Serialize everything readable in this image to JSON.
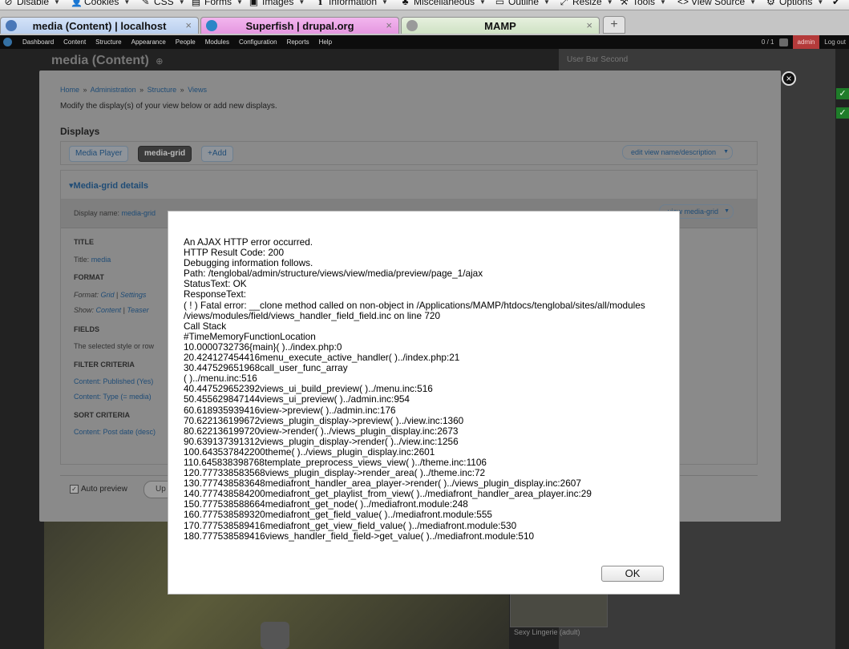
{
  "devbar": {
    "items": [
      {
        "icon": "disable-icon",
        "glyph": "⊘",
        "label": "Disable"
      },
      {
        "icon": "cookies-icon",
        "glyph": "👤",
        "label": "Cookies"
      },
      {
        "icon": "css-icon",
        "glyph": "✎",
        "label": "CSS"
      },
      {
        "icon": "forms-icon",
        "glyph": "▤",
        "label": "Forms"
      },
      {
        "icon": "images-icon",
        "glyph": "▣",
        "label": "Images"
      },
      {
        "icon": "information-icon",
        "glyph": "ℹ",
        "label": "Information"
      },
      {
        "icon": "miscellaneous-icon",
        "glyph": "♣",
        "label": "Miscellaneous"
      },
      {
        "icon": "outline-icon",
        "glyph": "▭",
        "label": "Outline"
      },
      {
        "icon": "resize-icon",
        "glyph": "⤢",
        "label": "Resize"
      },
      {
        "icon": "tools-icon",
        "glyph": "⚒",
        "label": "Tools"
      },
      {
        "icon": "view-source-icon",
        "glyph": "<>",
        "label": "View Source"
      },
      {
        "icon": "options-icon",
        "glyph": "⚙",
        "label": "Options"
      }
    ]
  },
  "tabs": [
    {
      "title": "media (Content) | localhost",
      "close": "×"
    },
    {
      "title": "Superfish | drupal.org",
      "close": "×"
    },
    {
      "title": "MAMP",
      "close": "×"
    }
  ],
  "new_tab": "+",
  "admin_toolbar": {
    "menu": [
      "Dashboard",
      "Content",
      "Structure",
      "Appearance",
      "People",
      "Modules",
      "Configuration",
      "Reports",
      "Help"
    ],
    "counter": "0 / 1",
    "user": "admin",
    "logout": "Log out"
  },
  "page": {
    "title": "media (Content)",
    "right_panel_title": "User Bar Second",
    "thumb_caption": "Sexy Lingerie (adult)"
  },
  "views": {
    "breadcrumb": [
      "Home",
      "Administration",
      "Structure",
      "Views"
    ],
    "breadcrumb_sep": "»",
    "intro": "Modify the display(s) of your view below or add new displays.",
    "displays_title": "Displays",
    "tabs": [
      "Media Player",
      "media-grid",
      "+Add"
    ],
    "edit_name": "edit view name/description",
    "details_title": "Media-grid details",
    "display_name_label": "Display name:",
    "display_name_value": "media-grid",
    "view_button": "view media-grid",
    "sections": {
      "title": "TITLE",
      "title_row_label": "Title:",
      "title_row_value": "media",
      "format": "FORMAT",
      "format_label": "Format:",
      "format_value": "Grid",
      "format_settings": "Settings",
      "show_label": "Show:",
      "show_value": "Content",
      "show_teaser": "Teaser",
      "fields": "FIELDS",
      "fields_note": "The selected style or row",
      "filter": "FILTER CRITERIA",
      "filter_1": "Content: Published (Yes)",
      "filter_2": "Content: Type (= media)",
      "sort": "SORT CRITERIA",
      "sort_1": "Content: Post date (desc)"
    },
    "auto_preview": "Auto preview",
    "update_button": "Up"
  },
  "error_dialog": {
    "lines": [
      "An AJAX HTTP error occurred.",
      "HTTP Result Code: 200",
      "Debugging information follows.",
      "Path: /tenglobal/admin/structure/views/view/media/preview/page_1/ajax",
      "StatusText: OK",
      "ResponseText:",
      "( ! ) Fatal error: __clone method called on non-object in /Applications/MAMP/htdocs/tenglobal/sites/all/modules",
      "/views/modules/field/views_handler_field_field.inc on line 720",
      "Call Stack",
      "#TimeMemoryFunctionLocation",
      "10.0000732736{main}( )../index.php:0",
      "20.424127454416menu_execute_active_handler( )../index.php:21",
      "30.447529651968call_user_func_array",
      "( )../menu.inc:516",
      "40.447529652392views_ui_build_preview( )../menu.inc:516",
      "50.455629847144views_ui_preview( )../admin.inc:954",
      "60.618935939416view->preview( )../admin.inc:176",
      "70.622136199672views_plugin_display->preview( )../view.inc:1360",
      "80.622136199720view->render( )../views_plugin_display.inc:2673",
      "90.639137391312views_plugin_display->render( )../view.inc:1256",
      "100.643537842200theme( )../views_plugin_display.inc:2601",
      "110.645838398768template_preprocess_views_view( )../theme.inc:1106",
      "120.777338583568views_plugin_display->render_area( )../theme.inc:72",
      "130.777438583648mediafront_handler_area_player->render( )../views_plugin_display.inc:2607",
      "140.777438584200mediafront_get_playlist_from_view( )../mediafront_handler_area_player.inc:29",
      "150.777538588664mediafront_get_node( )../mediafront.module:248",
      "160.777538589320mediafront_get_field_value( )../mediafront.module:555",
      "170.777538589416mediafront_get_view_field_value( )../mediafront.module:530",
      "180.777538589416views_handler_field_field->get_value( )../mediafront.module:510"
    ],
    "ok_label": "OK"
  }
}
